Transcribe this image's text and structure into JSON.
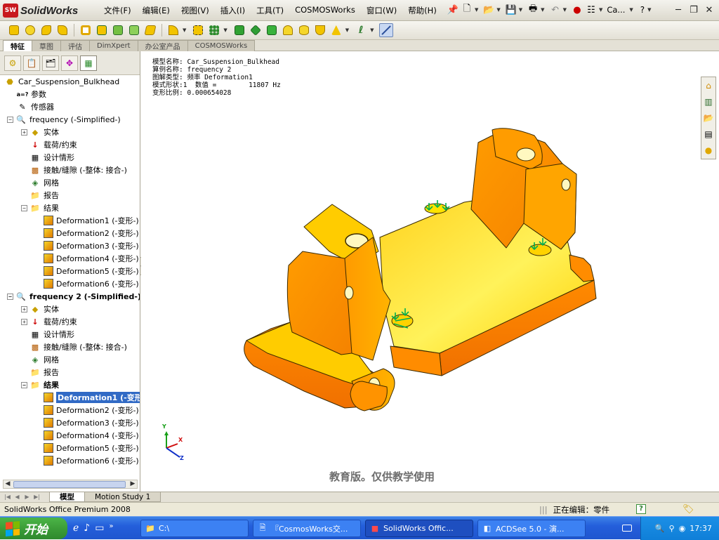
{
  "app": {
    "logo_text": "SolidWorks",
    "logo_badge": "SW"
  },
  "menu": [
    "文件(F)",
    "编辑(E)",
    "视图(V)",
    "插入(I)",
    "工具(T)",
    "COSMOSWorks",
    "窗口(W)",
    "帮助(H)"
  ],
  "quick_toolbar": {
    "doc_name": "Ca...",
    "help": "?"
  },
  "command_tabs": [
    "特征",
    "草图",
    "评估",
    "DimXpert",
    "办公室产品",
    "COSMOSWorks"
  ],
  "command_tabs_active": 0,
  "tree": {
    "root": "Car_Suspension_Bulkhead",
    "params": "参数",
    "sensors": "传感器",
    "study1": {
      "name": "frequency (-Simplified-)",
      "solid": "实体",
      "loads": "载荷/约束",
      "design": "设计情形",
      "contact": "接触/缝隙 (-整体: 接合-)",
      "mesh": "网格",
      "report": "报告",
      "results": "结果",
      "items": [
        "Deformation1 (-变形-)",
        "Deformation2 (-变形-)",
        "Deformation3 (-变形-)",
        "Deformation4 (-变形-)",
        "Deformation5 (-变形-)",
        "Deformation6 (-变形-)"
      ]
    },
    "study2": {
      "name": "frequency 2 (-Simplified-)",
      "solid": "实体",
      "loads": "载荷/约束",
      "design": "设计情形",
      "contact": "接触/缝隙 (-整体: 接合-)",
      "mesh": "网格",
      "report": "报告",
      "results": "结果",
      "items": [
        "Deformation1 (-变形",
        "Deformation2 (-变形-)",
        "Deformation3 (-变形-)",
        "Deformation4 (-变形-)",
        "Deformation5 (-变形-)",
        "Deformation6 (-变形-)"
      ]
    }
  },
  "plot_info": {
    "line1": "模型名称: Car_Suspension_Bulkhead",
    "line2": "算例名称: frequency 2",
    "line3": "图解类型: 频率 Deformation1",
    "line4": "模式形状:1  数值 =        11807 Hz",
    "line5": "变形比例: 0.000654028"
  },
  "triad": {
    "y": "Y",
    "x": "X",
    "z": "Z"
  },
  "watermark": "教育版。仅供教学使用",
  "bottom_tabs": [
    "模型",
    "Motion Study 1"
  ],
  "status": {
    "left": "SolidWorks Office Premium 2008",
    "editing": "正在编辑：零件",
    "help": "?"
  },
  "taskbar": {
    "start": "开始",
    "tasks": [
      "C:\\",
      "『CosmosWorks交...",
      "SolidWorks Offic...",
      "ACDSee 5.0 - 演..."
    ],
    "active_task": 2,
    "clock": "17:37"
  },
  "colors": {
    "part_light": "#ffef3a",
    "part_mid": "#ffb400",
    "part_dark": "#f07800",
    "selection": "#316ac5",
    "taskbar": "#245edb"
  }
}
